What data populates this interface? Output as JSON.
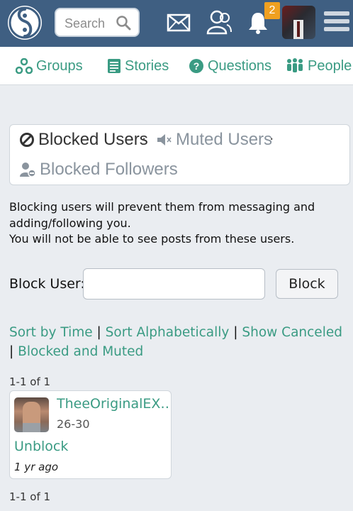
{
  "header": {
    "search_placeholder": "Search",
    "notification_count": "2"
  },
  "nav": {
    "items": [
      {
        "label": "Groups",
        "icon": "groups-icon"
      },
      {
        "label": "Stories",
        "icon": "stories-icon"
      },
      {
        "label": "Questions",
        "icon": "questions-icon"
      },
      {
        "label": "People",
        "icon": "people-icon"
      }
    ]
  },
  "tabs": {
    "blocked_users": "Blocked Users",
    "separator": "·",
    "muted_users": "Muted Users",
    "blocked_followers": "Blocked Followers"
  },
  "description": {
    "line1": "Blocking users will prevent them from messaging and adding/following you.",
    "line2": "You will not be able to see posts from these users."
  },
  "block_form": {
    "label": "Block User:",
    "input_value": "",
    "button_label": "Block"
  },
  "sort": {
    "by_time": "Sort by Time",
    "alphabetically": "Sort Alphabetically",
    "show_canceled": "Show Canceled",
    "blocked_and_muted": "Blocked and Muted",
    "divider": "|"
  },
  "pagination": {
    "top": "1-1 of 1",
    "bottom": "1-1 of 1"
  },
  "blocked_list": [
    {
      "username": "TheeOriginalEX…",
      "age_range": "26-30",
      "action": "Unblock",
      "time_ago": "1 yr ago"
    }
  ],
  "colors": {
    "header_bg": "#3f5f82",
    "accent": "#3a9b83",
    "badge": "#f0a020",
    "page_bg": "#eaedf1"
  }
}
